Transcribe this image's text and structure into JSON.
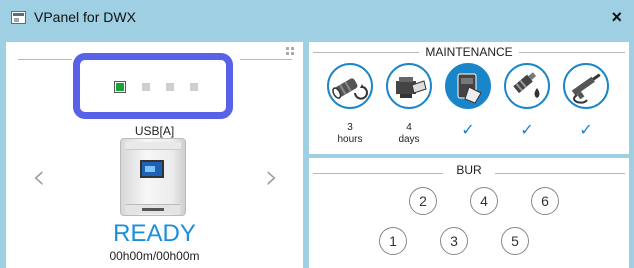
{
  "window": {
    "title": "VPanel for DWX",
    "close_glyph": "×"
  },
  "left": {
    "slots": [
      "active",
      "inactive",
      "inactive",
      "inactive"
    ],
    "source": "USB[A]",
    "status": "READY",
    "time": "00h00m/00h00m",
    "nav_prev": "‹",
    "nav_next": "›"
  },
  "maintenance": {
    "title": "MAINTENANCE",
    "items": [
      {
        "icon": "spindle-rotation-icon",
        "value": "3",
        "unit": "hours"
      },
      {
        "icon": "cleaning-icon",
        "value": "4",
        "unit": "days"
      },
      {
        "icon": "dust-collector-icon",
        "check": "✓"
      },
      {
        "icon": "oil-bottle-icon",
        "check": "✓"
      },
      {
        "icon": "air-blow-gun-icon",
        "check": "✓"
      }
    ]
  },
  "bur": {
    "title": "BUR",
    "slots": [
      "2",
      "4",
      "6",
      "1",
      "3",
      "5"
    ]
  },
  "colors": {
    "accent": "#1a86c9",
    "selector": "#5862e8",
    "ready": "#1a8fdc",
    "titlebar": "#9ecfe2"
  }
}
